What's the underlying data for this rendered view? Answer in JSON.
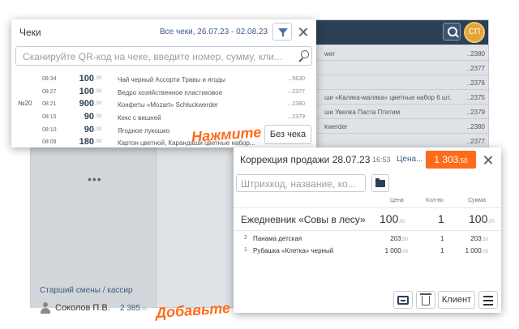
{
  "background_app": {
    "avatar_initials": "СП",
    "role_label": "Старший смены / кассир",
    "person_name": "Соколов П.В.",
    "person_amount": "2 385",
    "person_amount_kop": ",00",
    "dots": "•••",
    "rows": [
      {
        "text": "wer",
        "code": "..2380"
      },
      {
        "text": "",
        "code": "..2377"
      },
      {
        "text": "",
        "code": "..2376"
      },
      {
        "text": "ши «Каляка-маляка» цветные набор 6 шт.",
        "code": "..2375"
      },
      {
        "text": "ши Увелка Паста Птитим",
        "code": "..2379"
      },
      {
        "text": "kwerder",
        "code": "..2380"
      },
      {
        "text": "",
        "code": "..2377"
      }
    ]
  },
  "cheques_popup": {
    "title": "Чеки",
    "filter_label": "Все чеки, 26.07.23 - 02.08.23",
    "search_placeholder": "Сканируйте QR-код на чеке, введите номер, сумму, кли...",
    "receipt_number": "№20",
    "rows": [
      {
        "time": "08:34",
        "sum": "100",
        "kop": ",00",
        "name": "Чай черный Ассорти Травы и ягоды",
        "code": "...5630"
      },
      {
        "time": "08:27",
        "sum": "100",
        "kop": ",00",
        "name": "Ведро хозяйственное пластиковое",
        "code": "...2377"
      },
      {
        "time": "08:21",
        "sum": "900",
        "kop": ",00",
        "name": "Конфеты «Mozart» Schluckwerder",
        "code": "...2380"
      },
      {
        "time": "08:15",
        "sum": "90",
        "kop": ",00",
        "name": "Кекс с вишней",
        "code": "...2379"
      },
      {
        "time": "08:10",
        "sum": "90",
        "kop": ",00",
        "name": "Ягодное лукошко",
        "code": ""
      },
      {
        "time": "08:09",
        "sum": "180",
        "kop": ",00",
        "name": "Картон цветной, Карандаши цветные набор...",
        "code": ""
      }
    ],
    "no_cheque_button": "Без чека",
    "hint_text": "Нажмите"
  },
  "correction_popup": {
    "title": "Коррекция продажи",
    "date": "28.07.23",
    "time": "16:53",
    "price_label": "Цена...",
    "total": "1 303",
    "total_kop": ",50",
    "search_placeholder": "Штрихкод, название, ко...",
    "columns": {
      "price": "Цена",
      "qty": "Кол-во",
      "sum": "Сумма"
    },
    "main_item": {
      "name": "Ежедневник «Совы в лесу»",
      "price": "100",
      "price_kop": ",00",
      "qty": "1",
      "sum": "100",
      "sum_kop": ",00"
    },
    "items": [
      {
        "index": "2",
        "name": "Панама детская",
        "price": "203",
        "price_kop": ",50",
        "qty": "1",
        "sum": "203",
        "sum_kop": ",50"
      },
      {
        "index": "1",
        "name": "Рубашка «Клетка» черный",
        "price": "1 000",
        "price_kop": ",00",
        "qty": "1",
        "sum": "1 000",
        "sum_kop": ",00"
      }
    ],
    "client_button": "Клиент"
  },
  "hint_add": "Добавьте",
  "colors": {
    "accent": "#ff6b1a",
    "topbar": "#2d3f55",
    "link": "#3a5a86"
  }
}
